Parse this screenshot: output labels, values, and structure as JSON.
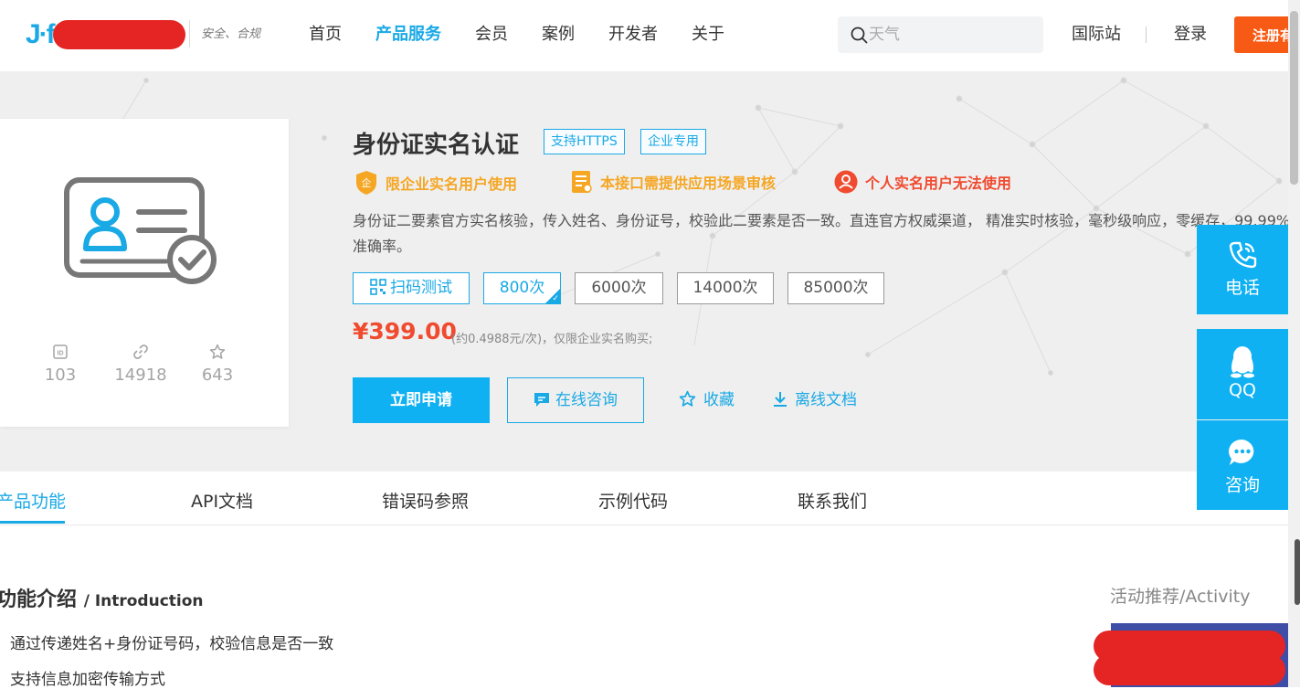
{
  "header": {
    "logo_text": "J·f",
    "slogan": "安全、合规",
    "nav": [
      "首页",
      "产品服务",
      "会员",
      "案例",
      "开发者",
      "关于"
    ],
    "nav_active_index": 1,
    "search_placeholder": "天气",
    "intl": "国际站",
    "login": "登录",
    "register": "注册有礼"
  },
  "product": {
    "title": "身份证实名认证",
    "tags": [
      "支持HTTPS",
      "企业专用"
    ],
    "warnings": [
      {
        "text": "限企业实名用户使用",
        "icon": "shield-enterprise-icon",
        "color": "#f5a623"
      },
      {
        "text": "本接口需提供应用场景审核",
        "icon": "document-review-icon",
        "color": "#f5a623"
      },
      {
        "text": "个人实名用户无法使用",
        "icon": "person-blocked-icon",
        "color": "#f04a2f"
      }
    ],
    "description": "身份证二要素官方实名核验，传入姓名、身份证号，校验此二要素是否一致。直连官方权威渠道， 精准实时核验，毫秒级响应，零缓存，99.99%准确率。",
    "stats": [
      {
        "icon": "id-icon",
        "value": "103"
      },
      {
        "icon": "link-icon",
        "value": "14918"
      },
      {
        "icon": "star-icon",
        "value": "643"
      }
    ],
    "scan_label": "扫码测试",
    "packages": [
      "800次",
      "6000次",
      "14000次",
      "85000次"
    ],
    "selected_package_index": 0,
    "price": "¥399.00",
    "price_note": "(约0.4988元/次)，仅限企业实名购买;",
    "apply_label": "立即申请",
    "consult_label": "在线咨询",
    "favorite_label": "收藏",
    "offline_doc_label": "离线文档"
  },
  "side_contact": [
    {
      "label": "电话",
      "icon": "phone-icon"
    },
    {
      "label": "QQ",
      "icon": "qq-penguin-icon"
    },
    {
      "label": "咨询",
      "icon": "chat-bubble-icon"
    }
  ],
  "tabs": [
    "产品功能",
    "API文档",
    "错误码参照",
    "示例代码",
    "联系我们"
  ],
  "active_tab_index": 0,
  "intro": {
    "title": "功能介绍",
    "title_en": "/ Introduction",
    "features": [
      "通过传递姓名+身份证号码，校验信息是否一致",
      "支持信息加密传输方式"
    ]
  },
  "activity": {
    "title": "活动推荐/Activity"
  },
  "colors": {
    "accent": "#19a9e5",
    "register_bg": "#f75a14",
    "price": "#f04a2f",
    "warning": "#f5a623"
  }
}
